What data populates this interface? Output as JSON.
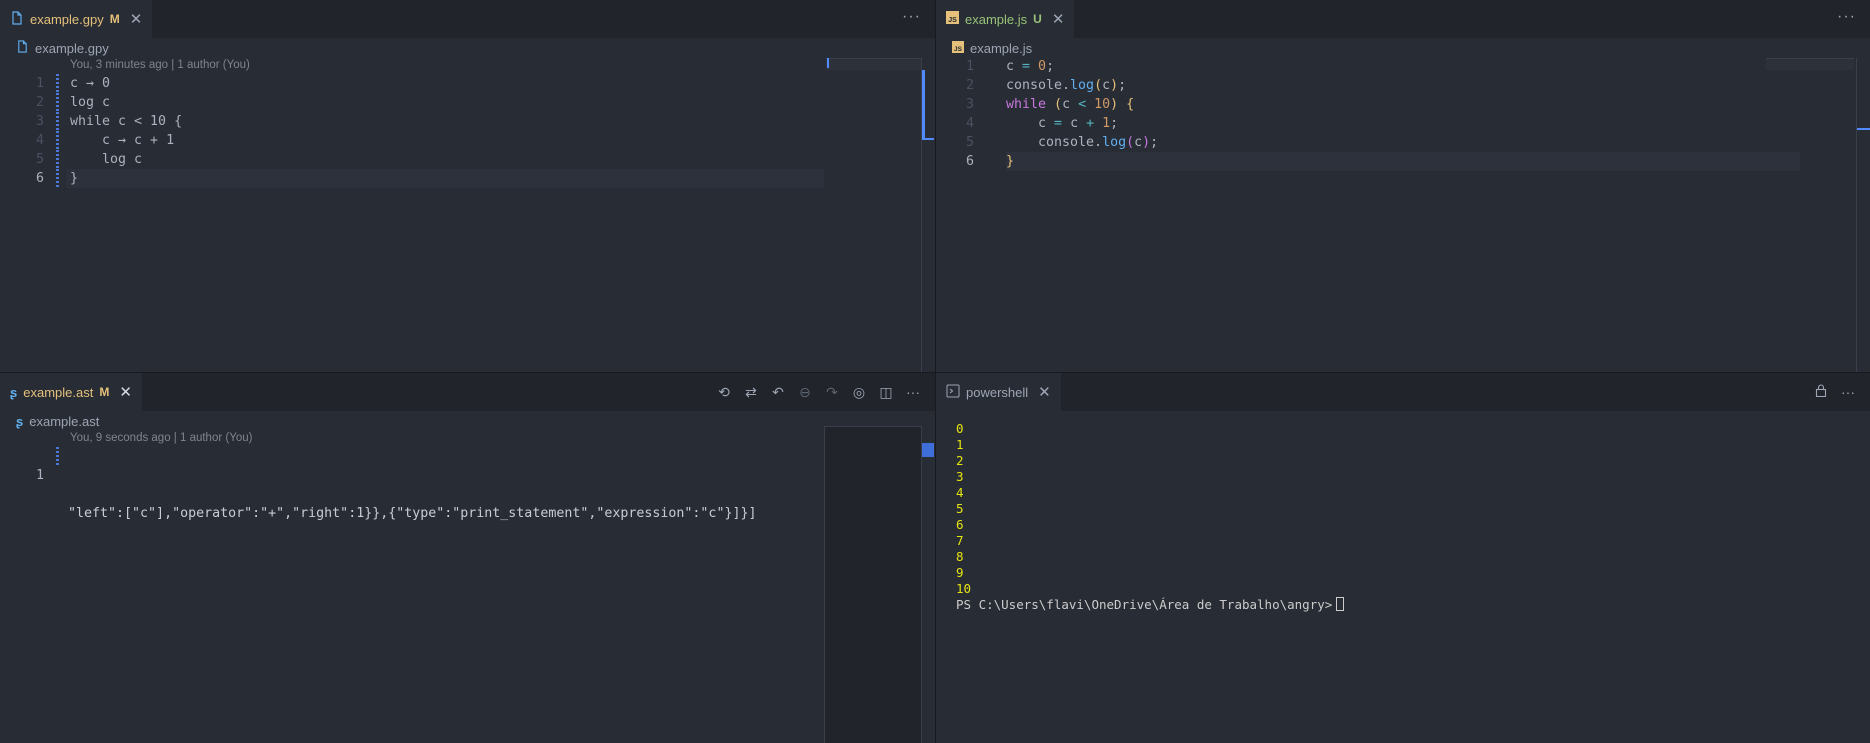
{
  "editors": {
    "top_left": {
      "tab": {
        "name": "example.gpy",
        "badge": "M",
        "color": "#e5c07b"
      },
      "breadcrumb": "example.gpy",
      "blame": "You, 3 minutes ago | 1 author (You)",
      "lines": [
        "c → 0",
        "log c",
        "while c < 10 {",
        "    c → c + 1",
        "    log c",
        "}"
      ],
      "line_numbers": [
        "1",
        "2",
        "3",
        "4",
        "5",
        "6"
      ]
    },
    "top_right": {
      "tab": {
        "name": "example.js",
        "badge": "U",
        "color": "#98c379"
      },
      "breadcrumb": "example.js",
      "line_numbers": [
        "1",
        "2",
        "3",
        "4",
        "5",
        "6"
      ]
    },
    "bottom_left": {
      "tab": {
        "name": "example.ast",
        "badge": "M",
        "color": "#e5c07b"
      },
      "breadcrumb": "example.ast",
      "blame": "You, 9 seconds ago | 1 author (You)",
      "line_number": "1",
      "line": "\"left\":[\"c\"],\"operator\":\"+\",\"right\":1}},{\"type\":\"print_statement\",\"expression\":\"c\"}]}]"
    }
  },
  "terminal": {
    "tab_name": "powershell",
    "output": [
      "0",
      "1",
      "2",
      "3",
      "4",
      "5",
      "6",
      "7",
      "8",
      "9",
      "10"
    ],
    "prompt": "PS C:\\Users\\flavi\\OneDrive\\Área de Trabalho\\angry>"
  },
  "icons": {
    "more": "more-actions-icon",
    "close": "close-icon",
    "file": "file-icon",
    "lock": "lock-icon"
  }
}
